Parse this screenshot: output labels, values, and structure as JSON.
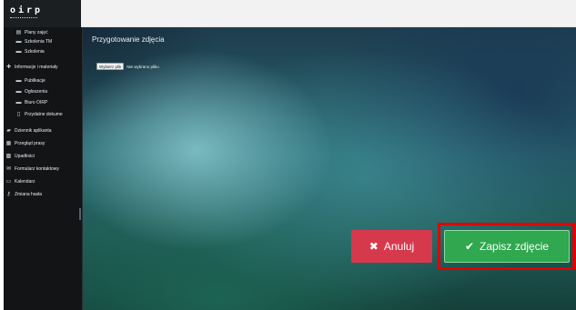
{
  "logo": {
    "text": "oirp"
  },
  "sidebar": {
    "items": [
      {
        "label": "Plany zajęć",
        "icon": "calendar-list-icon"
      },
      {
        "label": "Szkolenia TM",
        "icon": "folder-icon"
      },
      {
        "label": "Szkolenia",
        "icon": "folder-icon"
      },
      {
        "label": "Informacje i materiały",
        "icon": "plus-icon"
      },
      {
        "label": "Publikacje",
        "icon": "folder-icon"
      },
      {
        "label": "Ogłoszenia",
        "icon": "folder-icon"
      },
      {
        "label": "Biuro OIRP",
        "icon": "folder-icon"
      },
      {
        "label": "Przydatne dokume",
        "icon": "document-icon"
      },
      {
        "label": "Dziennik aplikanta",
        "icon": "book-icon"
      },
      {
        "label": "Przegląd prasy",
        "icon": "newspaper-icon"
      },
      {
        "label": "Upadłości",
        "icon": "grid-icon"
      },
      {
        "label": "Formularz kontaktowy",
        "icon": "chat-icon"
      },
      {
        "label": "Kalendarz",
        "icon": "calendar-icon"
      },
      {
        "label": "Zmiana hasła",
        "icon": "key-icon"
      }
    ]
  },
  "modal": {
    "title": "Przygotowanie zdjęcia",
    "file_button": "Wybierz plik",
    "file_status": "Nie wybrano pliku",
    "cancel_label": "Anuluj",
    "save_label": "Zapisz zdjęcie"
  },
  "colors": {
    "cancel": "#d7394c",
    "save": "#2fa84f",
    "highlight": "#e00000"
  }
}
